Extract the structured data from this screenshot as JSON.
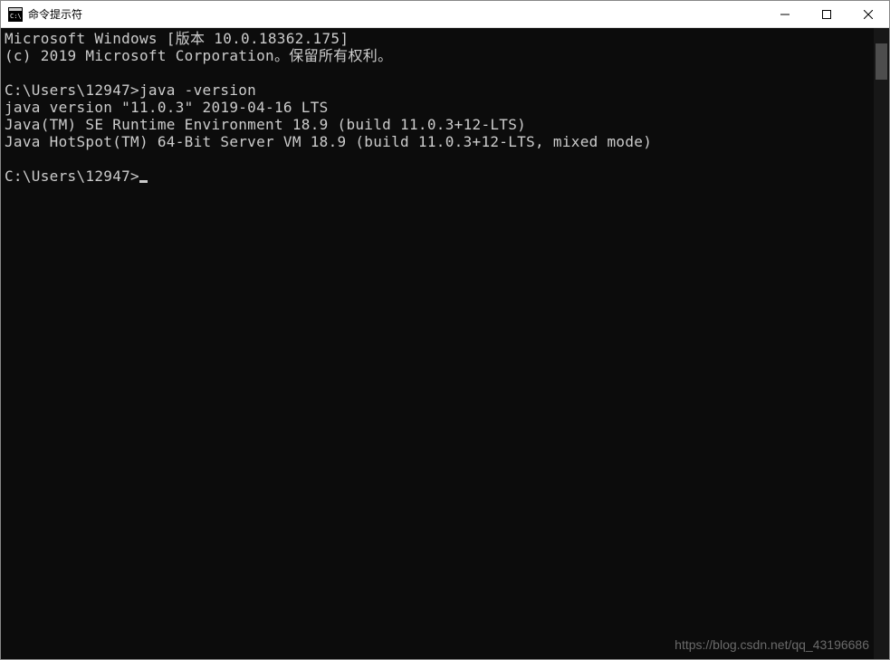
{
  "window": {
    "title": "命令提示符"
  },
  "terminal": {
    "line1": "Microsoft Windows [版本 10.0.18362.175]",
    "line2": "(c) 2019 Microsoft Corporation。保留所有权利。",
    "line3": "",
    "line4": "C:\\Users\\12947>java -version",
    "line5": "java version \"11.0.3\" 2019-04-16 LTS",
    "line6": "Java(TM) SE Runtime Environment 18.9 (build 11.0.3+12-LTS)",
    "line7": "Java HotSpot(TM) 64-Bit Server VM 18.9 (build 11.0.3+12-LTS, mixed mode)",
    "line8": "",
    "prompt": "C:\\Users\\12947>"
  },
  "watermark": "https://blog.csdn.net/qq_43196686"
}
